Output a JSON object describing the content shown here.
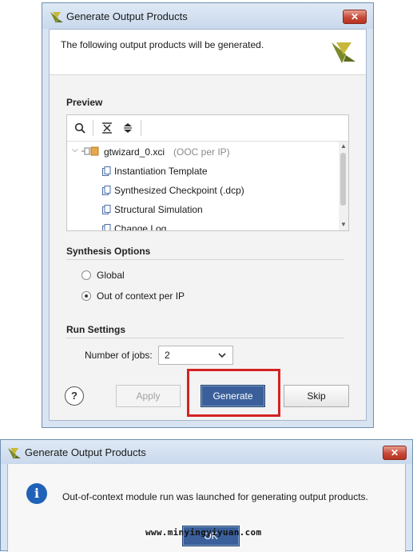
{
  "dialog1": {
    "title": "Generate Output Products",
    "close_label": "✕",
    "header_text": "The following output products will be generated.",
    "preview": {
      "section_title": "Preview",
      "toolbar": [
        "search-icon",
        "collapse-all-icon",
        "expand-all-icon"
      ],
      "tree": {
        "root_label": "gtwizard_0.xci",
        "root_suffix": "(OOC per IP)",
        "children": [
          "Instantiation Template",
          "Synthesized Checkpoint (.dcp)",
          "Structural Simulation",
          "Change Log"
        ]
      }
    },
    "synthesis": {
      "section_title": "Synthesis Options",
      "options": [
        {
          "label": "Global",
          "selected": false
        },
        {
          "label": "Out of context per IP",
          "selected": true
        }
      ]
    },
    "run": {
      "section_title": "Run Settings",
      "jobs_label": "Number of jobs:",
      "jobs_value": "2"
    },
    "buttons": {
      "help": "?",
      "apply": "Apply",
      "generate": "Generate",
      "skip": "Skip"
    },
    "colors": {
      "highlight": "#d42222",
      "primary_button": "#3a5f9a"
    }
  },
  "dialog2": {
    "title": "Generate Output Products",
    "close_label": "✕",
    "message": "Out-of-context module run was launched for generating output products.",
    "ok_label": "OK",
    "watermark": "www.minyingyiyuan.com"
  }
}
